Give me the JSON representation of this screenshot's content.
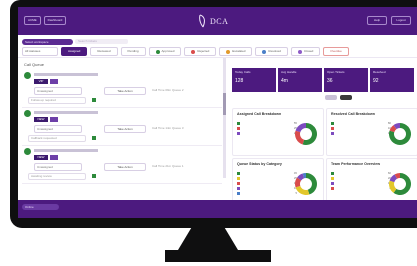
{
  "header": {
    "left_chips": [
      "ACME",
      "Dashboard"
    ],
    "logo_text": "DCA",
    "right_buttons": [
      "Help",
      "Logout"
    ]
  },
  "subbar": {
    "pill_label": "Select workspace",
    "search_placeholder": "Search tickets",
    "select_label": "All statuses",
    "tabs": [
      {
        "label": "Assigned",
        "active": true
      },
      {
        "label": "Reviewed"
      },
      {
        "label": "Pending"
      },
      {
        "label": "Approved",
        "dot": "#2d8a3b"
      },
      {
        "label": "Rejected",
        "dot": "#d94c4c"
      },
      {
        "label": "Escalated",
        "dot": "#e29a2b"
      },
      {
        "label": "Resolved",
        "dot": "#4a7ec8"
      },
      {
        "label": "Closed",
        "dot": "#8e5bc7"
      },
      {
        "label": "Overdue",
        "warn": true
      }
    ]
  },
  "left_panel": {
    "title": "Call Queue",
    "items": [
      {
        "tag": "VIP",
        "select": "Unassigned",
        "button": "Take Action",
        "note": "Call Time 09m  Queue 2",
        "sub": "Follow-up required"
      },
      {
        "tag": "NEW",
        "select": "Unassigned",
        "button": "Take Action",
        "note": "Call Time 14m  Queue 3",
        "sub": "Callback requested"
      },
      {
        "tag": "NEW",
        "select": "Unassigned",
        "button": "Take Action",
        "note": "Call Time 21m  Queue 1",
        "sub": "Awaiting review"
      }
    ]
  },
  "stats": [
    {
      "label": "Today Calls",
      "value": "128"
    },
    {
      "label": "Avg Handle",
      "value": "4m"
    },
    {
      "label": "Open Tickets",
      "value": "36"
    },
    {
      "label": "Resolved",
      "value": "92"
    }
  ],
  "cards": [
    {
      "title": "Assigned Call Breakdown"
    },
    {
      "title": "Resolved Call Breakdown"
    },
    {
      "title": "Queue Status by Category"
    },
    {
      "title": "Team Performance Overview"
    }
  ],
  "chart_data": [
    {
      "type": "pie",
      "title": "Assigned Call Breakdown",
      "series": [
        {
          "values": [
            55,
            25,
            20
          ]
        }
      ],
      "colors": [
        "#2d8a3b",
        "#d94c4c",
        "#7d4bbf"
      ]
    },
    {
      "type": "pie",
      "title": "Resolved Call Breakdown",
      "series": [
        {
          "values": [
            80,
            10,
            10
          ]
        }
      ],
      "colors": [
        "#2d8a3b",
        "#d94c4c",
        "#7d4bbf"
      ]
    },
    {
      "type": "pie",
      "title": "Queue Status by Category",
      "series": [
        {
          "values": [
            45,
            25,
            15,
            10,
            5
          ]
        }
      ],
      "colors": [
        "#2d8a3b",
        "#e2c72b",
        "#d94c4c",
        "#7d4bbf",
        "#4a7ec8"
      ]
    },
    {
      "type": "pie",
      "title": "Team Performance Overview",
      "series": [
        {
          "values": [
            60,
            20,
            12,
            8
          ]
        }
      ],
      "colors": [
        "#2d8a3b",
        "#e2c72b",
        "#7d4bbf",
        "#d94c4c"
      ]
    }
  ],
  "footer": {
    "chip": "Online"
  }
}
